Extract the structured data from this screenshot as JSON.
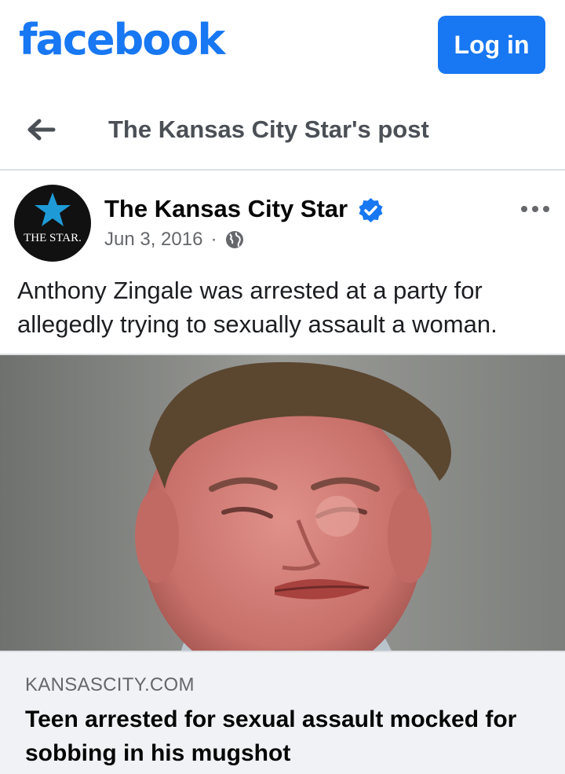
{
  "header": {
    "logo_text": "facebook",
    "login_label": "Log in",
    "brand_color": "#1877f2"
  },
  "nav": {
    "back_icon": "arrow-left-icon",
    "title": "The Kansas City Star's post"
  },
  "post": {
    "avatar_text": "THE STAR.",
    "page_name": "The Kansas City Star",
    "verified_icon": "verified-badge-icon",
    "date": "Jun 3, 2016",
    "separator": "·",
    "audience_icon": "globe-icon",
    "more_icon": "more-options-icon",
    "text": "Anthony Zingale was arrested at a party for allegedly trying to sexually assault a woman."
  },
  "link_preview": {
    "domain": "KANSASCITY.COM",
    "title": "Teen arrested for sexual assault mocked for sobbing in his mugshot"
  }
}
